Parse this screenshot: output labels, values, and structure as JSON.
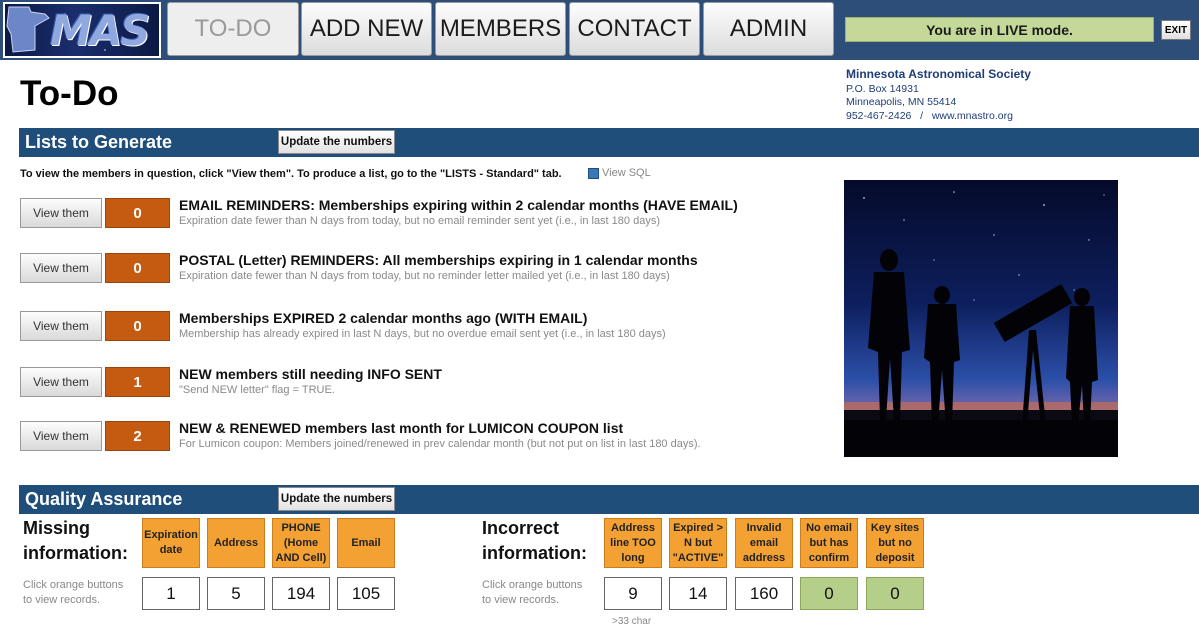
{
  "nav": {
    "logo_text": "MAS",
    "tabs": [
      "TO-DO",
      "ADD NEW",
      "MEMBERS",
      "CONTACT",
      "ADMIN"
    ],
    "active_tab": "TO-DO",
    "mode_text": "You are in LIVE mode.",
    "exit_label": "EXIT"
  },
  "header": {
    "title": "To-Do",
    "org_name": "Minnesota Astronomical Society",
    "address1": "P.O. Box 14931",
    "address2": "Minneapolis, MN  55414",
    "phone": "952-467-2426",
    "separator": "/",
    "website": "www.mnastro.org"
  },
  "lists": {
    "section_title": "Lists to Generate",
    "update_label": "Update the numbers",
    "instructions": "To view the members in question, click \"View them\".  To produce a list, go to the \"LISTS  - Standard\" tab.",
    "view_sql_label": "View SQL",
    "view_label": "View them",
    "rows": [
      {
        "count": "0",
        "title": "EMAIL REMINDERS: Memberships expiring within 2 calendar months (HAVE EMAIL)",
        "desc": "Expiration date fewer than N days from today, but no email reminder sent yet (i.e., in last 180 days)"
      },
      {
        "count": "0",
        "title": "POSTAL (Letter) REMINDERS: All memberships expiring in 1 calendar months",
        "desc": "Expiration date fewer than N days from today, but no reminder letter mailed yet (i.e., in last 180 days)"
      },
      {
        "count": "0",
        "title": "Memberships EXPIRED 2 calendar months ago (WITH EMAIL)",
        "desc": "Membership has already expired in last N days, but no overdue email sent yet (i.e., in last 180 days)"
      },
      {
        "count": "1",
        "title": "NEW members still needing INFO SENT",
        "desc": "\"Send NEW letter\" flag = TRUE."
      },
      {
        "count": "2",
        "title": "NEW & RENEWED members last month for LUMICON COUPON list",
        "desc": "For Lumicon coupon:  Members joined/renewed in prev calendar month (but not put on list in last 180 days)."
      }
    ]
  },
  "qa": {
    "section_title": "Quality Assurance",
    "update_label": "Update the numbers",
    "missing": {
      "heading_line1": "Missing",
      "heading_line2": "information:",
      "note_line1": "Click orange buttons",
      "note_line2": "to view records.",
      "items": [
        {
          "label": "Expiration date",
          "value": "1"
        },
        {
          "label": "Address",
          "value": "5"
        },
        {
          "label": "PHONE (Home AND Cell)",
          "value": "194"
        },
        {
          "label": "Email",
          "value": "105"
        }
      ]
    },
    "incorrect": {
      "heading_line1": "Incorrect",
      "heading_line2": "information:",
      "note_line1": "Click orange buttons",
      "note_line2": "to view records.",
      "items": [
        {
          "label": "Address line TOO long",
          "value": "9"
        },
        {
          "label": "Expired > N but \"ACTIVE\"",
          "value": "14"
        },
        {
          "label": "Invalid email address",
          "value": "160"
        },
        {
          "label": "No email but has confirm",
          "value": "0"
        },
        {
          "label": "Key sites but no deposit",
          "value": "0"
        }
      ],
      "char_note": ">33 char"
    }
  },
  "colors": {
    "nav_bar": "#2e4e7a",
    "section_bar": "#1f4e7a",
    "count_box": "#c55a11",
    "qa_button": "#f4a133",
    "live_box": "#c4d89a",
    "ok_value": "#b5cf8a"
  },
  "icons": {
    "logo": "minnesota-state-shape-icon",
    "view_sql": "checkbox-icon"
  }
}
